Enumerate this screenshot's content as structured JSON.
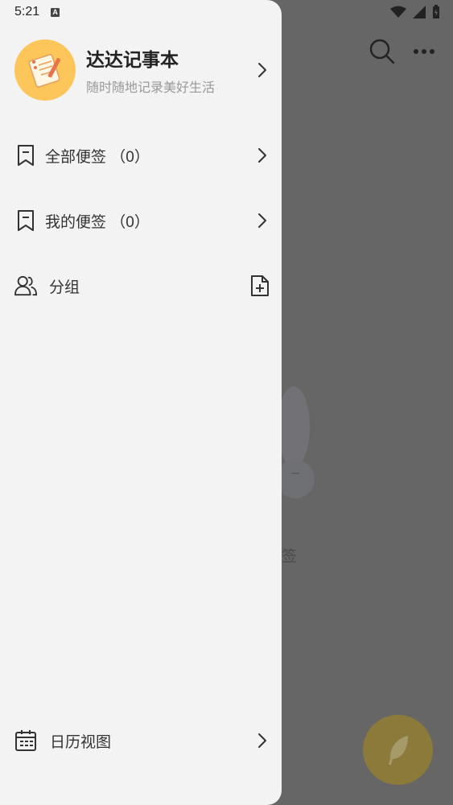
{
  "status_bar": {
    "time": "5:21",
    "notification_badge": "A"
  },
  "background": {
    "empty_text": "签",
    "icons": [
      "search-icon",
      "more-icon",
      "feather-icon"
    ]
  },
  "drawer": {
    "profile": {
      "app_name": "达达记事本",
      "slogan": "随时随地记录美好生活",
      "avatar_icon": "notebook-pencil-icon"
    },
    "menu": [
      {
        "label": "全部便签 （0）",
        "icon": "bookmark-icon",
        "action_icon": "chevron-right-icon"
      },
      {
        "label": "我的便签 （0）",
        "icon": "bookmark-icon",
        "action_icon": "chevron-right-icon"
      },
      {
        "label": "分组",
        "icon": "users-icon",
        "action_icon": "add-file-icon"
      }
    ],
    "bottom": {
      "label": "日历视图",
      "icon": "calendar-icon",
      "action_icon": "chevron-right-icon"
    }
  },
  "colors": {
    "drawer_bg": "#f3f3f3",
    "overlay": "#666666",
    "avatar_bg": "#fcc65a",
    "fab": "#8c7a3a"
  }
}
